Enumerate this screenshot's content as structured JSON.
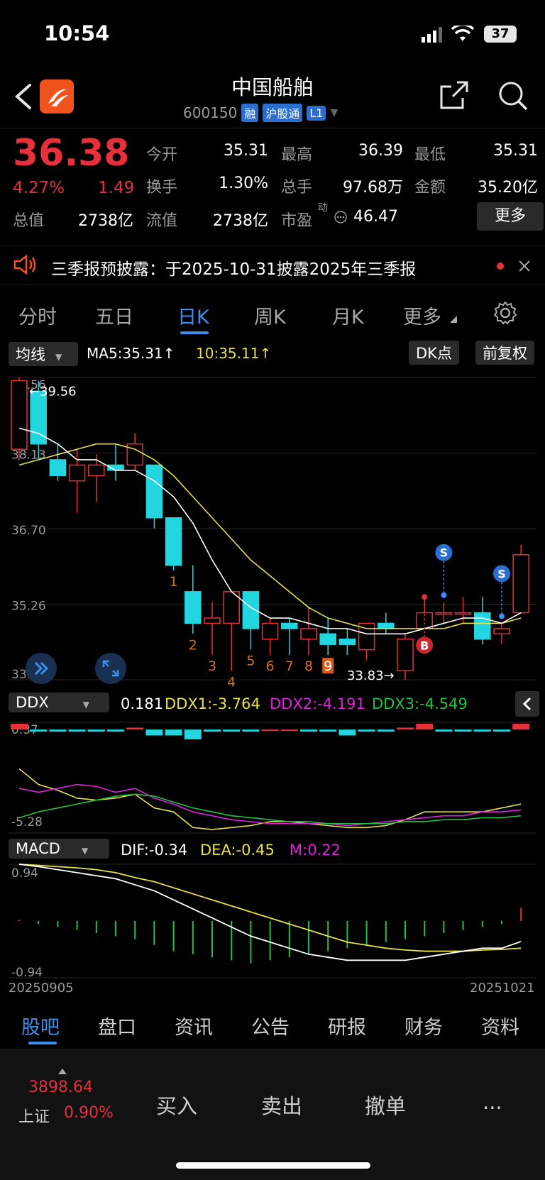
{
  "status": {
    "time": "10:54",
    "battery": "37"
  },
  "header": {
    "title": "中国船舶",
    "code": "600150",
    "tags": [
      "融",
      "沪股通",
      "L1"
    ]
  },
  "quote": {
    "price": "36.38",
    "pct": "4.27%",
    "change": "1.49",
    "rows": [
      [
        {
          "l": "今开",
          "v": "35.31",
          "red": true
        },
        {
          "l": "最高",
          "v": "36.39",
          "red": true
        },
        {
          "l": "最低",
          "v": "35.31",
          "red": true
        }
      ],
      [
        {
          "l": "换手",
          "v": "1.30%",
          "red": false
        },
        {
          "l": "总手",
          "v": "97.68万",
          "red": false
        },
        {
          "l": "金额",
          "v": "35.20亿",
          "red": false
        }
      ]
    ],
    "row3": {
      "l1": "总值",
      "v1": "2738亿",
      "l2": "流值",
      "v2": "2738亿",
      "l3": "市盈",
      "sup": "动",
      "v3": "46.47"
    },
    "more": "更多"
  },
  "notice": {
    "text": "三季报预披露：于2025-10-31披露2025年三季报"
  },
  "tabs": [
    "分时",
    "五日",
    "日K",
    "周K",
    "月K",
    "更多"
  ],
  "toolbar": {
    "ma_select": "均线",
    "ma5": "MA5:35.31↑",
    "ma10": "10:35.11↑",
    "dk": "DK点",
    "fq": "前复权"
  },
  "colors": {
    "up": "#e8303a",
    "down": "#22d6e0",
    "ma5": "#ffffff",
    "ma10": "#e8e04a",
    "accent": "#3a8ff0"
  },
  "chart_data": [
    {
      "type": "candlestick",
      "price_ticks": [
        "39.56",
        "38.13",
        "36.70",
        "35.26",
        "33.83"
      ],
      "ylim": [
        33.83,
        39.56
      ],
      "high_label": "←39.56",
      "low_label": "33.83→",
      "candles": [
        {
          "o": 38.2,
          "c": 39.5,
          "h": 39.56,
          "l": 38.0
        },
        {
          "o": 39.3,
          "c": 38.3,
          "h": 39.5,
          "l": 38.0
        },
        {
          "o": 38.0,
          "c": 37.7,
          "h": 38.3,
          "l": 37.6
        },
        {
          "o": 37.6,
          "c": 37.9,
          "h": 38.2,
          "l": 37.0
        },
        {
          "o": 37.7,
          "c": 37.9,
          "h": 38.1,
          "l": 37.2
        },
        {
          "o": 37.9,
          "c": 37.8,
          "h": 38.3,
          "l": 37.6
        },
        {
          "o": 37.9,
          "c": 38.3,
          "h": 38.5,
          "l": 37.8
        },
        {
          "o": 37.9,
          "c": 36.9,
          "h": 37.9,
          "l": 36.7
        },
        {
          "o": 36.9,
          "c": 36.0,
          "h": 36.9,
          "l": 35.9
        },
        {
          "o": 35.5,
          "c": 34.9,
          "h": 36.0,
          "l": 34.7
        },
        {
          "o": 34.9,
          "c": 35.0,
          "h": 35.3,
          "l": 34.3
        },
        {
          "o": 34.9,
          "c": 35.5,
          "h": 35.5,
          "l": 34.0
        },
        {
          "o": 35.5,
          "c": 34.8,
          "h": 35.5,
          "l": 34.4
        },
        {
          "o": 34.6,
          "c": 34.9,
          "h": 35.0,
          "l": 34.3
        },
        {
          "o": 34.9,
          "c": 34.8,
          "h": 35.0,
          "l": 34.3
        },
        {
          "o": 34.6,
          "c": 34.8,
          "h": 35.2,
          "l": 34.3
        },
        {
          "o": 34.7,
          "c": 34.5,
          "h": 35.0,
          "l": 34.3
        },
        {
          "o": 34.6,
          "c": 34.5,
          "h": 34.8,
          "l": 34.3
        },
        {
          "o": 34.4,
          "c": 34.9,
          "h": 34.9,
          "l": 34.2
        },
        {
          "o": 34.9,
          "c": 34.8,
          "h": 35.1,
          "l": 34.7
        },
        {
          "o": 34.0,
          "c": 34.6,
          "h": 34.7,
          "l": 33.83
        },
        {
          "o": 34.8,
          "c": 35.1,
          "h": 35.4,
          "l": 34.8
        },
        {
          "o": 35.1,
          "c": 35.1,
          "h": 35.3,
          "l": 34.9
        },
        {
          "o": 35.1,
          "c": 35.1,
          "h": 35.4,
          "l": 34.9
        },
        {
          "o": 35.1,
          "c": 34.6,
          "h": 35.4,
          "l": 34.5
        },
        {
          "o": 34.7,
          "c": 34.8,
          "h": 34.9,
          "l": 34.5
        },
        {
          "o": 35.1,
          "c": 36.2,
          "h": 36.39,
          "l": 35.1
        }
      ],
      "ma5": [
        38.6,
        38.5,
        38.3,
        38.0,
        38.0,
        37.8,
        37.8,
        37.6,
        37.3,
        36.8,
        36.1,
        35.5,
        35.2,
        35.0,
        35.0,
        34.9,
        34.8,
        34.8,
        34.7,
        34.7,
        34.7,
        34.8,
        34.9,
        35.0,
        35.0,
        34.9,
        35.1
      ],
      "ma10": [
        37.9,
        38.0,
        38.1,
        38.2,
        38.3,
        38.3,
        38.2,
        38.0,
        37.7,
        37.3,
        36.9,
        36.5,
        36.1,
        35.8,
        35.5,
        35.2,
        35.0,
        34.9,
        34.8,
        34.8,
        34.8,
        34.8,
        34.8,
        34.9,
        34.9,
        34.9,
        35.0
      ],
      "markers": [
        {
          "i": 8,
          "t": "1"
        },
        {
          "i": 9,
          "t": "2"
        },
        {
          "i": 10,
          "t": "3"
        },
        {
          "i": 11,
          "t": "4"
        },
        {
          "i": 12,
          "t": "5"
        },
        {
          "i": 13,
          "t": "6"
        },
        {
          "i": 14,
          "t": "7"
        },
        {
          "i": 15,
          "t": "8"
        },
        {
          "i": 16,
          "t": "9"
        }
      ],
      "signals": [
        {
          "i": 22,
          "t": "S"
        },
        {
          "i": 25,
          "t": "S"
        },
        {
          "i": 21,
          "t": "B"
        }
      ]
    },
    {
      "type": "line",
      "name": "DDX",
      "header": {
        "select": "DDX",
        "val": "0.181",
        "ddx1": "DDX1:-3.764",
        "ddx2": "DDX2:-4.191",
        "ddx3": "DDX3:-4.549"
      },
      "ticks": [
        "0.37",
        "-5.28"
      ],
      "ylim": [
        -5.28,
        0.37
      ],
      "bars": [
        0.3,
        -0.1,
        -0.1,
        -0.1,
        -0.1,
        -0.1,
        0.1,
        -0.3,
        -0.3,
        -0.5,
        -0.1,
        -0.1,
        -0.1,
        0.0,
        0.0,
        -0.1,
        -0.1,
        -0.3,
        -0.1,
        -0.1,
        0.1,
        0.3,
        -0.1,
        -0.1,
        -0.1,
        -0.1,
        0.3
      ],
      "series": [
        {
          "name": "DDX1",
          "values": [
            -2.0,
            -2.8,
            -3.1,
            -3.5,
            -3.6,
            -3.5,
            -3.3,
            -4.0,
            -4.2,
            -5.0,
            -5.1,
            -5.0,
            -4.9,
            -4.7,
            -4.7,
            -4.8,
            -4.9,
            -5.0,
            -5.0,
            -4.9,
            -4.6,
            -4.2,
            -4.2,
            -4.2,
            -4.2,
            -4.0,
            -3.8
          ]
        },
        {
          "name": "DDX2",
          "values": [
            -3.0,
            -3.2,
            -3.0,
            -2.8,
            -2.9,
            -3.2,
            -3.0,
            -3.5,
            -3.8,
            -4.2,
            -4.4,
            -4.6,
            -4.7,
            -4.8,
            -4.8,
            -4.8,
            -4.8,
            -4.9,
            -4.8,
            -4.7,
            -4.6,
            -4.5,
            -4.4,
            -4.4,
            -4.2,
            -4.2,
            -4.1
          ]
        },
        {
          "name": "DDX3",
          "values": [
            -4.5,
            -4.2,
            -4.0,
            -3.8,
            -3.6,
            -3.4,
            -3.3,
            -3.4,
            -3.7,
            -4.0,
            -4.2,
            -4.4,
            -4.5,
            -4.6,
            -4.7,
            -4.7,
            -4.8,
            -4.8,
            -4.8,
            -4.8,
            -4.7,
            -4.7,
            -4.6,
            -4.6,
            -4.5,
            -4.5,
            -4.4
          ]
        }
      ]
    },
    {
      "type": "bar",
      "name": "MACD",
      "header": {
        "select": "MACD",
        "dif": "DIF:-0.34",
        "dea": "DEA:-0.45",
        "m": "M:0.22"
      },
      "ticks": [
        "0.94",
        "-0.94"
      ],
      "ylim": [
        -0.94,
        0.94
      ],
      "hist": [
        0.02,
        -0.05,
        -0.1,
        -0.15,
        -0.2,
        -0.25,
        -0.3,
        -0.4,
        -0.5,
        -0.55,
        -0.6,
        -0.65,
        -0.7,
        -0.65,
        -0.6,
        -0.55,
        -0.5,
        -0.45,
        -0.4,
        -0.35,
        -0.3,
        -0.25,
        -0.2,
        -0.15,
        -0.1,
        -0.05,
        0.22
      ],
      "dif": [
        0.94,
        0.9,
        0.85,
        0.8,
        0.75,
        0.7,
        0.6,
        0.5,
        0.35,
        0.2,
        0.05,
        -0.1,
        -0.25,
        -0.35,
        -0.45,
        -0.55,
        -0.6,
        -0.65,
        -0.65,
        -0.65,
        -0.65,
        -0.6,
        -0.55,
        -0.5,
        -0.45,
        -0.45,
        -0.34
      ],
      "dea": [
        0.94,
        0.92,
        0.9,
        0.88,
        0.85,
        0.8,
        0.72,
        0.65,
        0.55,
        0.45,
        0.35,
        0.25,
        0.15,
        0.05,
        -0.05,
        -0.15,
        -0.25,
        -0.35,
        -0.4,
        -0.45,
        -0.48,
        -0.5,
        -0.5,
        -0.5,
        -0.48,
        -0.47,
        -0.45
      ],
      "date_start": "20250905",
      "date_end": "20251021"
    }
  ],
  "bottom_tabs": [
    "股吧",
    "盘口",
    "资讯",
    "公告",
    "研报",
    "财务",
    "资料"
  ],
  "trade": {
    "index_val": "3898.64",
    "index_name": "上证",
    "index_pct": "0.90%",
    "buy": "买入",
    "sell": "卖出",
    "cancel": "撤单",
    "more": "..."
  }
}
